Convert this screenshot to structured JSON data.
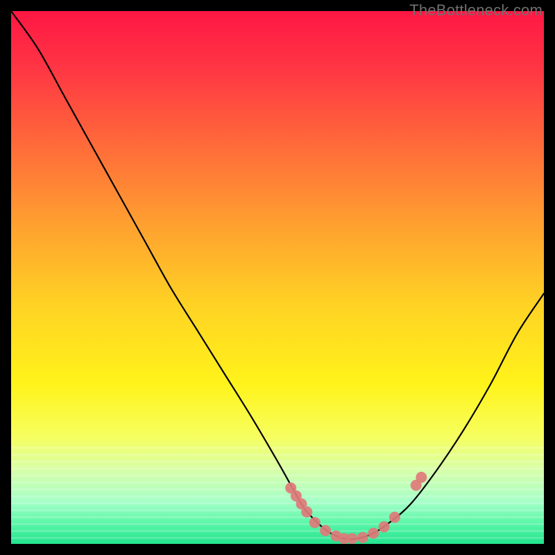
{
  "watermark": "TheBottleneck.com",
  "chart_data": {
    "type": "line",
    "title": "",
    "xlabel": "",
    "ylabel": "",
    "xlim": [
      0,
      1
    ],
    "ylim": [
      0,
      1
    ],
    "grid": false,
    "legend": false,
    "background": {
      "kind": "vertical-gradient",
      "stops": [
        {
          "offset": 0.0,
          "color": "#ff1744"
        },
        {
          "offset": 0.1,
          "color": "#ff3344"
        },
        {
          "offset": 0.25,
          "color": "#ff6a3a"
        },
        {
          "offset": 0.4,
          "color": "#ffa030"
        },
        {
          "offset": 0.55,
          "color": "#ffd224"
        },
        {
          "offset": 0.7,
          "color": "#fff31a"
        },
        {
          "offset": 0.8,
          "color": "#f6ff60"
        },
        {
          "offset": 0.86,
          "color": "#d8ffa8"
        },
        {
          "offset": 0.92,
          "color": "#a6ffc8"
        },
        {
          "offset": 0.96,
          "color": "#5cf7a8"
        },
        {
          "offset": 1.0,
          "color": "#22e38f"
        }
      ]
    },
    "series": [
      {
        "name": "bottleneck-curve",
        "color": "#000000",
        "x": [
          0.0,
          0.05,
          0.1,
          0.15,
          0.2,
          0.25,
          0.3,
          0.35,
          0.4,
          0.45,
          0.5,
          0.545,
          0.56,
          0.58,
          0.6,
          0.625,
          0.65,
          0.68,
          0.71,
          0.75,
          0.8,
          0.85,
          0.9,
          0.95,
          1.0
        ],
        "y": [
          1.0,
          0.93,
          0.84,
          0.75,
          0.66,
          0.57,
          0.48,
          0.4,
          0.32,
          0.24,
          0.155,
          0.075,
          0.055,
          0.035,
          0.02,
          0.01,
          0.01,
          0.02,
          0.04,
          0.075,
          0.14,
          0.215,
          0.3,
          0.395,
          0.47
        ]
      }
    ],
    "markers": {
      "name": "highlighted-points",
      "color": "#e07a7a",
      "radius_px": 8,
      "x": [
        0.525,
        0.535,
        0.545,
        0.555,
        0.57,
        0.59,
        0.61,
        0.625,
        0.64,
        0.66,
        0.68,
        0.7,
        0.72,
        0.76,
        0.77
      ],
      "y": [
        0.105,
        0.09,
        0.075,
        0.06,
        0.04,
        0.025,
        0.015,
        0.01,
        0.01,
        0.012,
        0.02,
        0.032,
        0.05,
        0.11,
        0.125
      ]
    }
  }
}
